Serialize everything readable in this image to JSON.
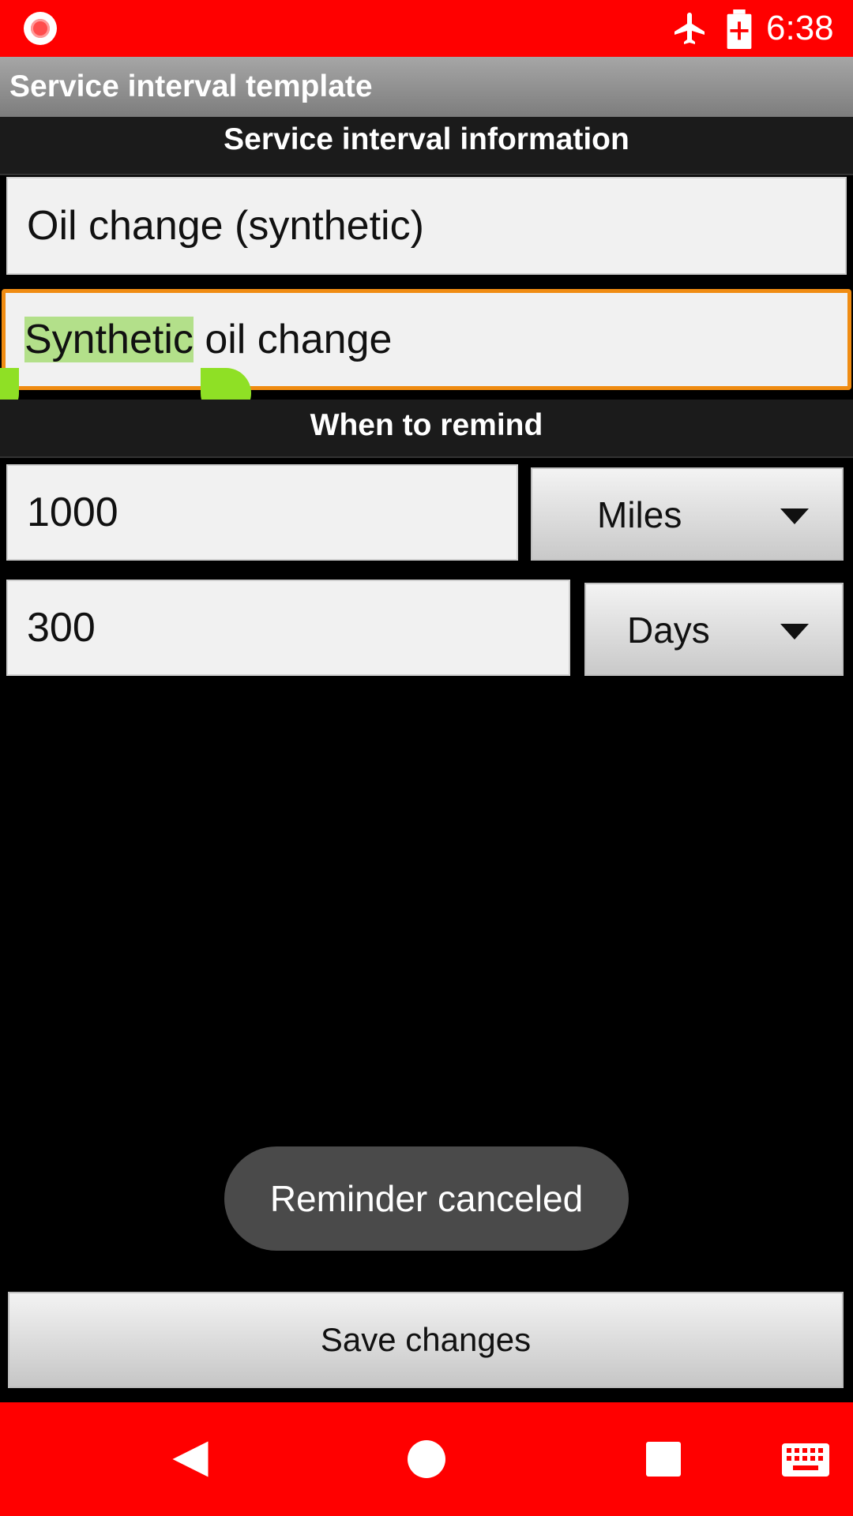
{
  "status_bar": {
    "time": "6:38",
    "icons": [
      "record-icon",
      "airplane-mode-icon",
      "battery-charging-icon"
    ]
  },
  "action_bar": {
    "title": "Service interval template"
  },
  "section_info": {
    "title": "Service interval information"
  },
  "name_field": {
    "value": "Oil change (synthetic)"
  },
  "description_field": {
    "selected_text": "Synthetic",
    "remaining_text": " oil change"
  },
  "section_remind": {
    "title": "When to remind"
  },
  "distance": {
    "value": "1000",
    "unit": "Miles"
  },
  "time_interval": {
    "value": "300",
    "unit": "Days"
  },
  "toast": {
    "text": "Reminder canceled"
  },
  "save_button": {
    "label": "Save changes"
  },
  "nav_bar": {
    "icons": [
      "back-icon",
      "home-icon",
      "recents-icon",
      "keyboard-icon"
    ]
  },
  "colors": {
    "status_bar": "#ff0000",
    "selection": "#b3e08a",
    "handles": "#8fe025",
    "focus_border": "#f08c12"
  }
}
